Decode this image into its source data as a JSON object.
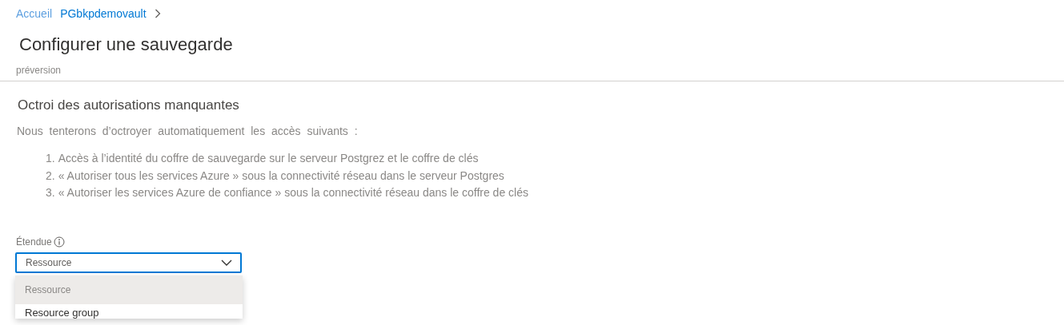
{
  "breadcrumb": [
    {
      "label": "Accueil"
    },
    {
      "label": "PGbkpdemovault"
    }
  ],
  "page": {
    "title": "Configurer une sauvegarde",
    "subtitle": "préversion"
  },
  "section": {
    "heading": "Octroi des autorisations manquantes",
    "intro": "Nous tenterons d’octroyer automatiquement les accès suivants :",
    "items": [
      {
        "number": "1.",
        "text": "Accès à l’identité du coffre de sauvegarde sur le serveur Postgrez et le coffre de clés"
      },
      {
        "number": "2.",
        "text": "« Autoriser tous les services Azure » sous la connectivité réseau dans le serveur Postgres"
      },
      {
        "number": "3.",
        "text": "« Autoriser les services Azure de confiance » sous la connectivité réseau dans le coffre de clés"
      }
    ]
  },
  "scope": {
    "label": "Étendue",
    "value": "Ressource",
    "expanded": true,
    "options": [
      {
        "label": "Ressource",
        "selected": true
      },
      {
        "label": "Resource group",
        "selected": false
      }
    ]
  }
}
